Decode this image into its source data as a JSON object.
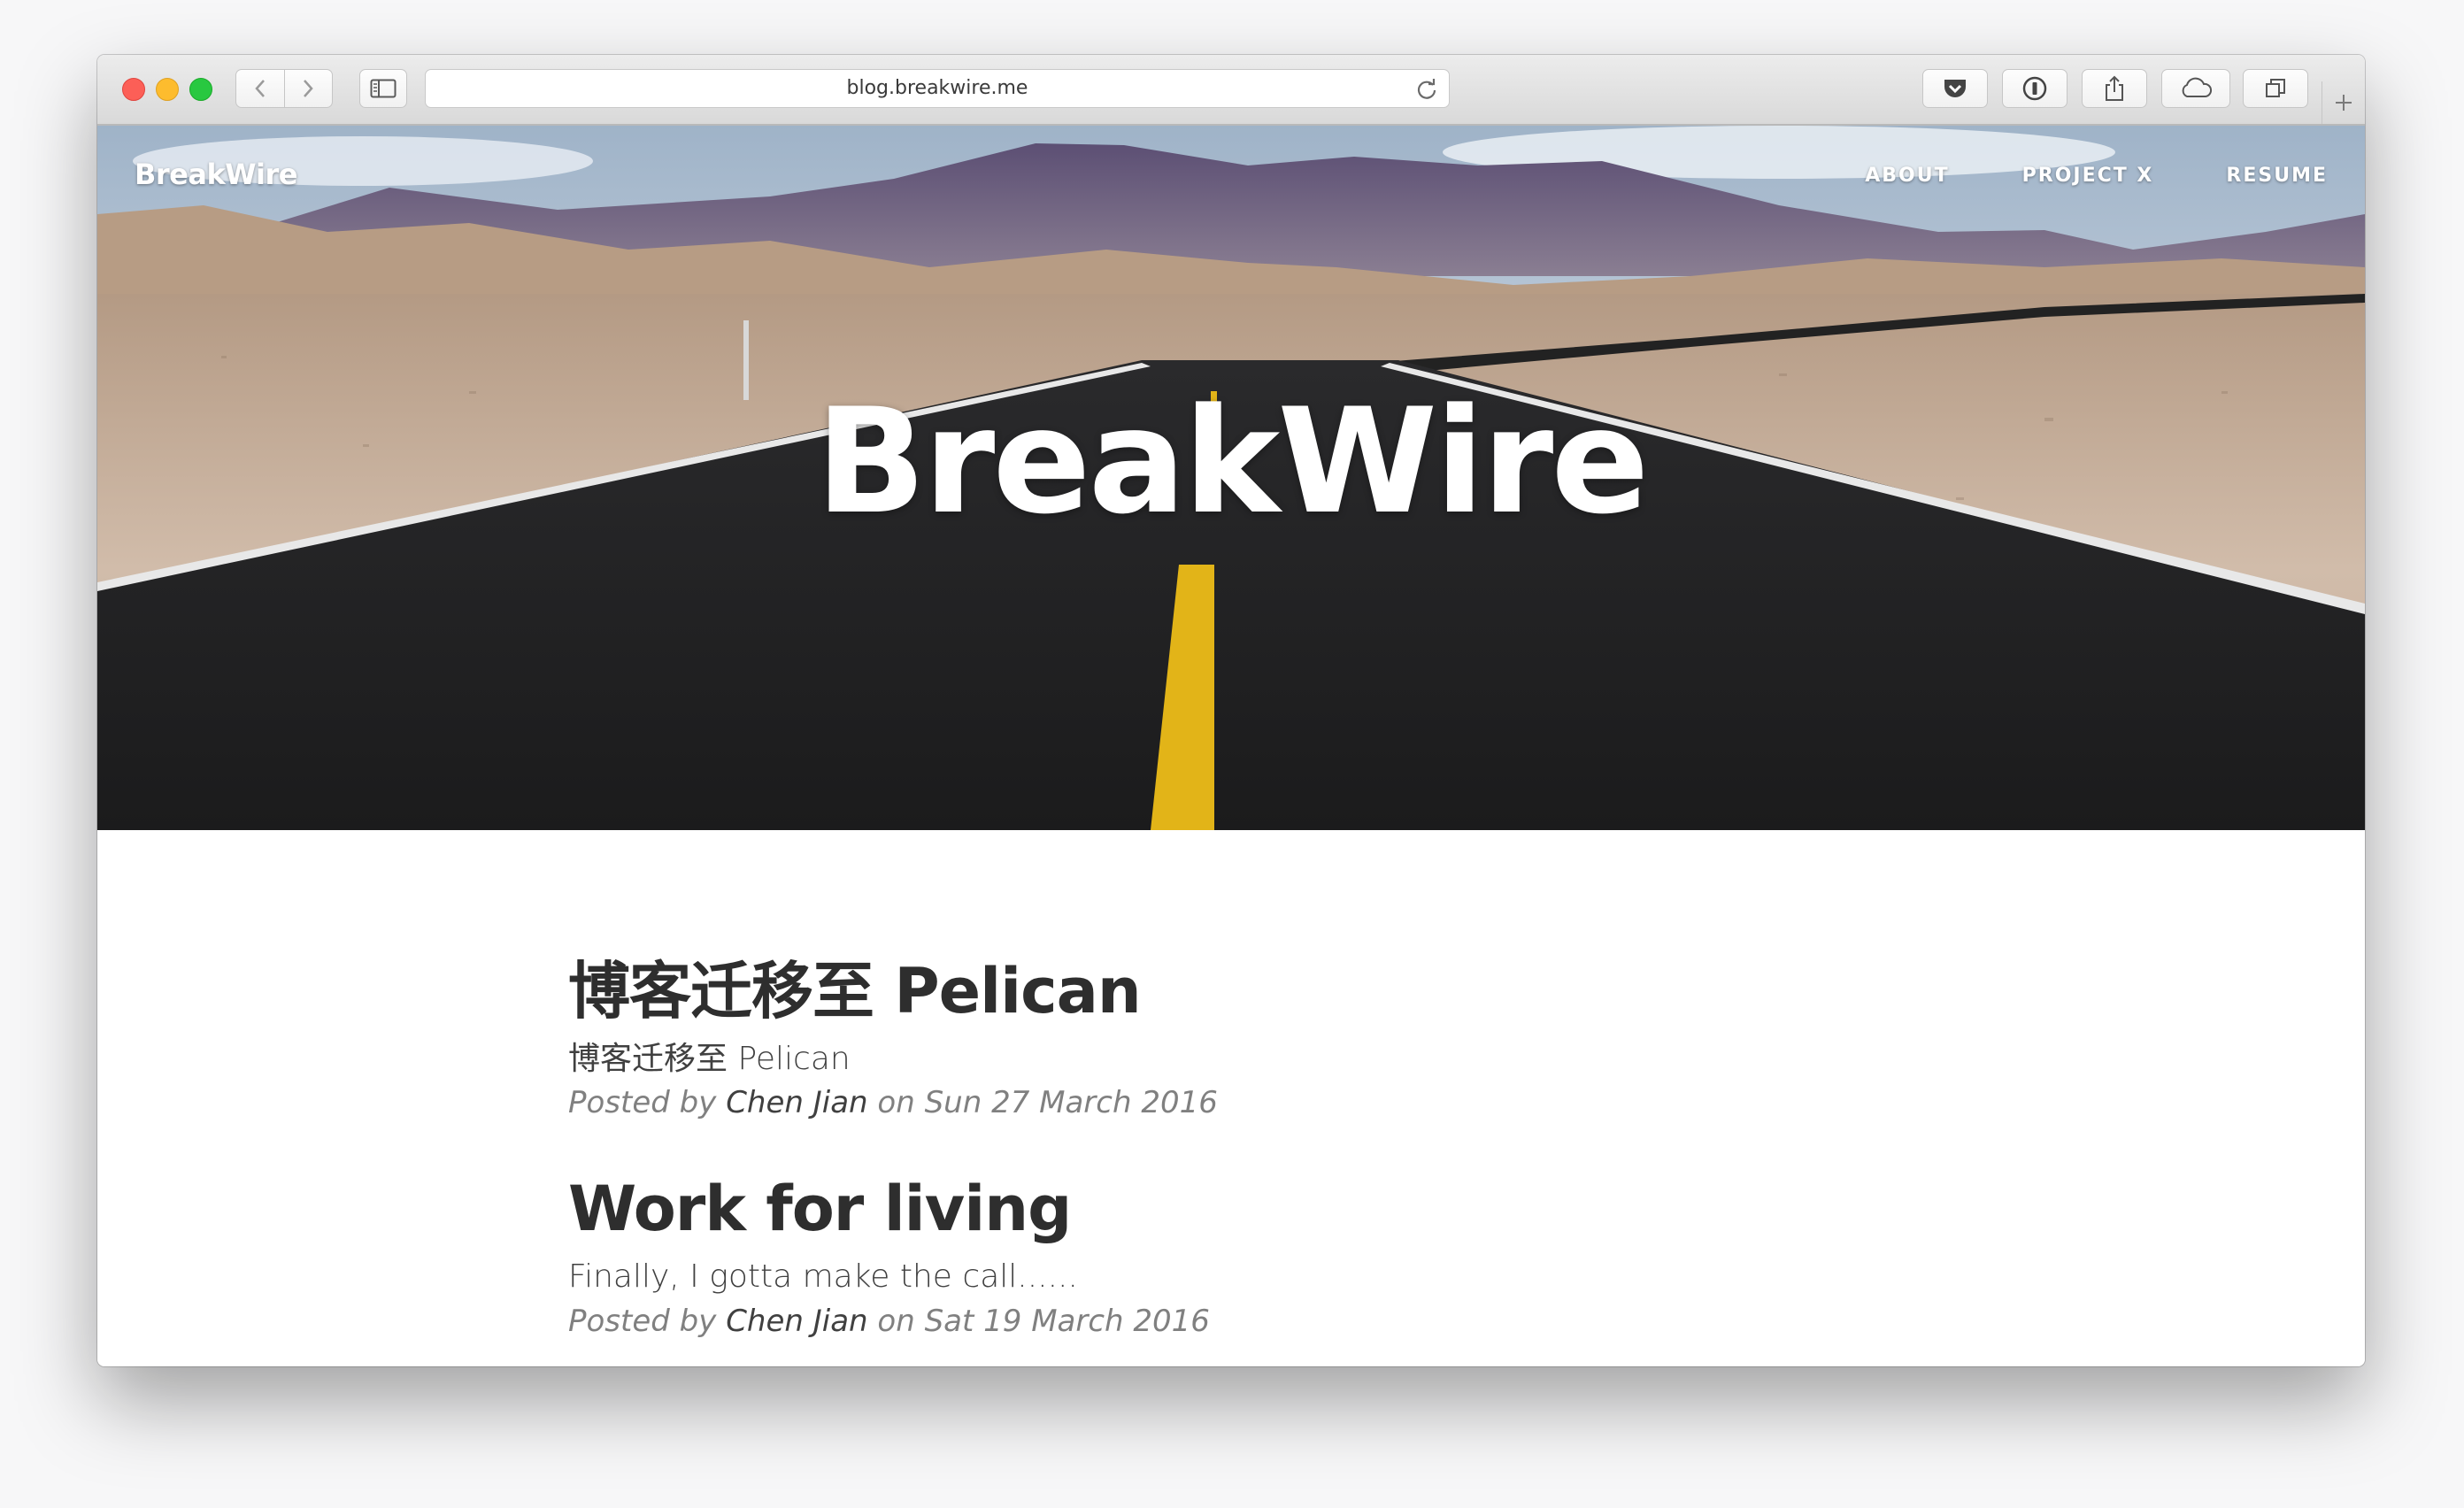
{
  "browser": {
    "url": "blog.breakwire.me"
  },
  "site": {
    "brand": "BreakWire",
    "nav": [
      "ABOUT",
      "PROJECT X",
      "RESUME"
    ],
    "hero_title": "BreakWire"
  },
  "posts": [
    {
      "title": "博客迁移至 Pelican",
      "subtitle": "博客迁移至 Pelican",
      "posted_by": "Posted by",
      "author": "Chen Jian",
      "on_date": "on Sun 27 March 2016"
    },
    {
      "title": "Work for living",
      "subtitle": "Finally, I gotta make the call......",
      "posted_by": "Posted by",
      "author": "Chen Jian",
      "on_date": "on Sat 19 March 2016"
    }
  ],
  "colors": {
    "road": "#1f1f20",
    "center_line": "#e2b418",
    "sky": "#b8c6d6",
    "desert": "#c9b09a",
    "mountains": "#6b5d7a"
  }
}
